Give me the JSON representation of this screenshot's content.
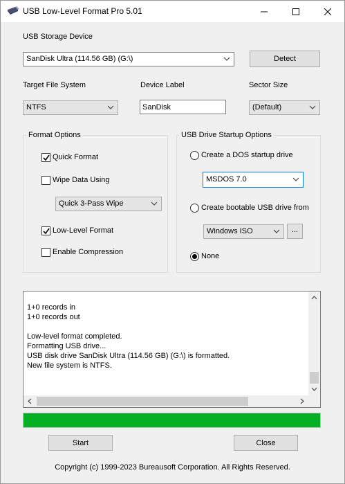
{
  "window": {
    "title": "USB Low-Level Format Pro 5.01",
    "controls": [
      "minimize-icon",
      "maximize-icon",
      "close-icon"
    ]
  },
  "device": {
    "label": "USB Storage Device",
    "selected": "SanDisk Ultra (114.56 GB) (G:\\)",
    "detect_label": "Detect"
  },
  "filesystem": {
    "label": "Target File System",
    "selected": "NTFS"
  },
  "device_label": {
    "label": "Device Label",
    "value": "SanDisk"
  },
  "sector": {
    "label": "Sector Size",
    "selected": "(Default)"
  },
  "format_options": {
    "title": "Format Options",
    "quick_format": {
      "label": "Quick Format",
      "checked": true
    },
    "wipe_data": {
      "label": "Wipe Data Using",
      "checked": false
    },
    "wipe_method": "Quick 3-Pass Wipe",
    "low_level": {
      "label": "Low-Level Format",
      "checked": true
    },
    "compression": {
      "label": "Enable Compression",
      "checked": false
    }
  },
  "startup_options": {
    "title": "USB Drive Startup Options",
    "dos": {
      "label": "Create a DOS startup drive",
      "selected": false
    },
    "dos_version": "MSDOS 7.0",
    "bootable": {
      "label": "Create bootable USB drive from",
      "selected": false
    },
    "bootable_source": "Windows ISO",
    "browse_label": "...",
    "none": {
      "label": "None",
      "selected": true
    }
  },
  "log": {
    "lines": [
      "1+0 records in",
      "1+0 records out",
      "",
      "Low-level format completed.",
      "Formatting USB drive...",
      "USB disk drive SanDisk Ultra (114.56 GB) (G:\\) is formatted.",
      "New file system is NTFS."
    ]
  },
  "progress": {
    "percent": 100,
    "color": "#06b025"
  },
  "buttons": {
    "start": "Start",
    "close": "Close"
  },
  "footer": {
    "copyright": "Copyright (c) 1999-2023 Bureausoft Corporation. All Rights Reserved."
  },
  "colors": {
    "accent": "#0078d7",
    "window_bg": "#f0f0f0"
  }
}
